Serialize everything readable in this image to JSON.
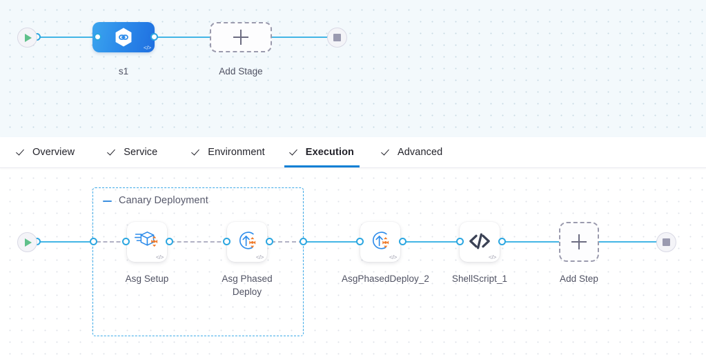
{
  "colors": {
    "accent_blue": "#0b7fd4",
    "edge_blue": "#42b5e5",
    "port_blue": "#2ba6e0",
    "group_dash_blue": "#3ba9e8",
    "stage_node_blue": "#2c8bea",
    "start_green": "#5fc08a",
    "stop_grey": "#9a9ab0",
    "step_icon_orange": "#f07a2a",
    "stage_canvas_bg": "#f3f9fc",
    "steps_canvas_bg": "#ffffff"
  },
  "stage_canvas": {
    "start_node": {
      "name": "pipeline-start",
      "icon": "play-icon"
    },
    "end_node": {
      "name": "pipeline-end",
      "icon": "stop-icon"
    },
    "stages": [
      {
        "label": "s1",
        "icon": "hexagon-infinity-icon",
        "badge": "</>"
      }
    ],
    "add_stage": {
      "label": "Add Stage",
      "icon": "plus-icon"
    }
  },
  "tabs": {
    "items": [
      {
        "label": "Overview",
        "active": false,
        "checked": true
      },
      {
        "label": "Service",
        "active": false,
        "checked": true
      },
      {
        "label": "Environment",
        "active": false,
        "checked": true
      },
      {
        "label": "Execution",
        "active": true,
        "checked": true
      },
      {
        "label": "Advanced",
        "active": false,
        "checked": true
      }
    ]
  },
  "steps_canvas": {
    "start_node": {
      "name": "execution-start",
      "icon": "play-icon"
    },
    "end_node": {
      "name": "execution-end",
      "icon": "stop-icon"
    },
    "group": {
      "title": "Canary Deployment",
      "collapse_icon": "minus-icon"
    },
    "steps": [
      {
        "label": "Asg Setup",
        "icon": "asg-setup-icon",
        "badge": "</>",
        "in_group": true
      },
      {
        "label": "Asg Phased Deploy",
        "icon": "asg-phased-deploy-icon",
        "badge": "</>",
        "in_group": true
      },
      {
        "label": "AsgPhasedDeploy_2",
        "icon": "asg-phased-deploy-icon",
        "badge": "</>",
        "in_group": false
      },
      {
        "label": "ShellScript_1",
        "icon": "shell-script-code-icon",
        "badge": "</>",
        "in_group": false
      }
    ],
    "add_step": {
      "label": "Add Step",
      "icon": "plus-icon"
    }
  }
}
